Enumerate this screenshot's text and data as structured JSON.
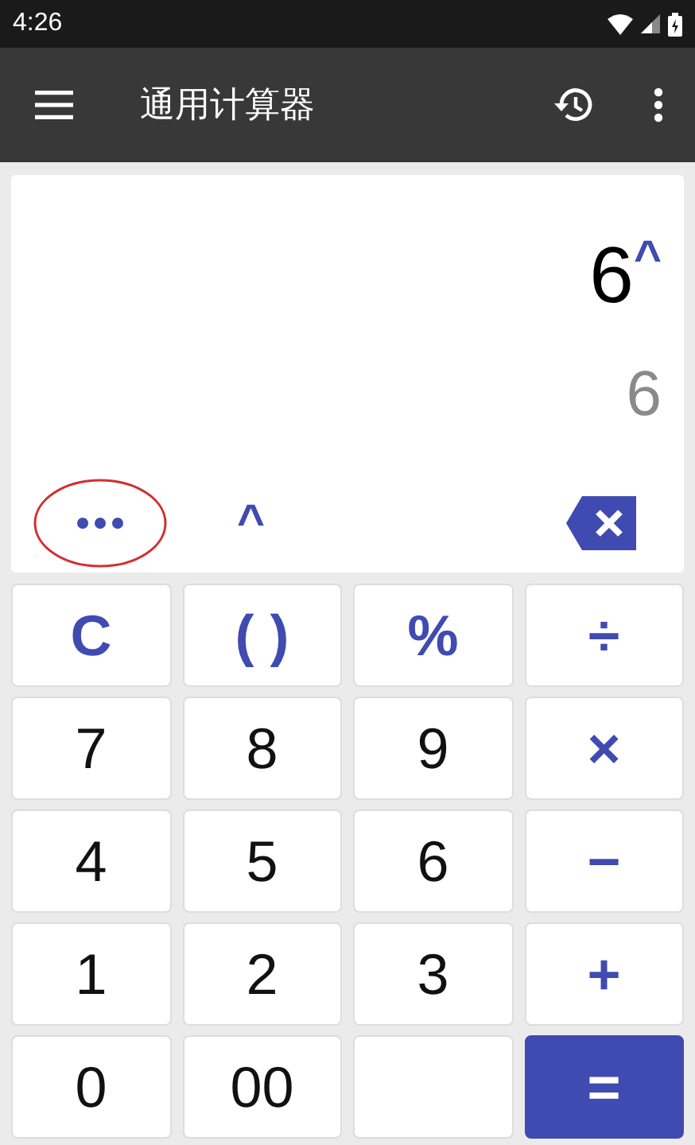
{
  "status_bar": {
    "time": "4:26"
  },
  "app_bar": {
    "title": "通用计算器"
  },
  "display": {
    "expression": "6",
    "expression_operator": "^",
    "result": "6",
    "more_highlighted": true,
    "operator_key": "^"
  },
  "keys": [
    {
      "label": "C",
      "kind": "op"
    },
    {
      "label": "( )",
      "kind": "op"
    },
    {
      "label": "%",
      "kind": "op"
    },
    {
      "label": "÷",
      "kind": "op"
    },
    {
      "label": "7",
      "kind": "digit"
    },
    {
      "label": "8",
      "kind": "digit"
    },
    {
      "label": "9",
      "kind": "digit"
    },
    {
      "label": "×",
      "kind": "op"
    },
    {
      "label": "4",
      "kind": "digit"
    },
    {
      "label": "5",
      "kind": "digit"
    },
    {
      "label": "6",
      "kind": "digit"
    },
    {
      "label": "−",
      "kind": "op"
    },
    {
      "label": "1",
      "kind": "digit"
    },
    {
      "label": "2",
      "kind": "digit"
    },
    {
      "label": "3",
      "kind": "digit"
    },
    {
      "label": "+",
      "kind": "op"
    },
    {
      "label": "0",
      "kind": "digit"
    },
    {
      "label": "00",
      "kind": "digit"
    },
    {
      "kind": "blank"
    },
    {
      "label": "=",
      "kind": "equals"
    }
  ]
}
